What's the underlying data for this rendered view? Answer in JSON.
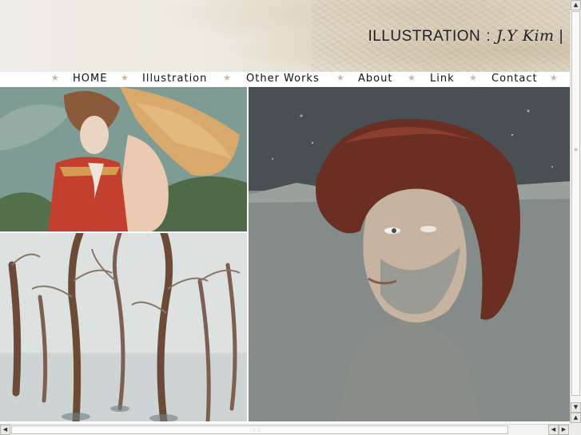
{
  "header": {
    "title": "ILLUSTRATION",
    "separator": ":",
    "author": "J.Y Kim",
    "bar": "|"
  },
  "nav": {
    "star": "★",
    "items": [
      "HOME",
      "Illustration",
      "Other Works",
      "About",
      "Link",
      "Contact"
    ]
  },
  "colors": {
    "star": "#c9b8a4",
    "nav_text": "#111111",
    "title_text": "#222222",
    "header_bg": "#efebe3"
  },
  "icons": {
    "scroll_up": "triangle-up",
    "scroll_down": "triangle-down",
    "scroll_left": "triangle-left",
    "scroll_right": "triangle-right"
  }
}
